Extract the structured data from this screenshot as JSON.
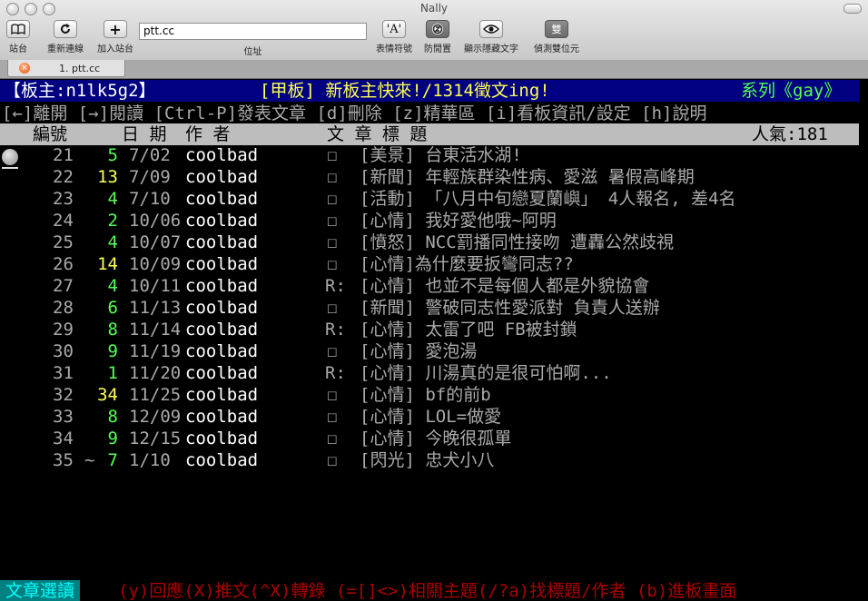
{
  "window": {
    "title": "Nally"
  },
  "toolbar": {
    "sites": {
      "label": "站台",
      "icon": "book-icon"
    },
    "reconnect": {
      "label": "重新連線",
      "icon": "reload-icon"
    },
    "add_site": {
      "label": "加入站台",
      "icon": "plus-icon"
    },
    "address": {
      "value": "ptt.cc",
      "label": "位址"
    },
    "emoticons": {
      "label": "表情符號",
      "icon": "emoticon-icon"
    },
    "anti_idle": {
      "label": "防閒置",
      "icon": "anti-idle-icon"
    },
    "show_hidden": {
      "label": "顯示隱藏文字",
      "icon": "eye-icon"
    },
    "detect_dbcs": {
      "label": "偵測雙位元",
      "icon_text": "雙"
    }
  },
  "tab": {
    "label": "1. ptt.cc"
  },
  "terminal": {
    "header": {
      "board_master": "【板主:n1lk5g2】",
      "board_title": "[甲板] 新板主快來!/1314徵文ing!",
      "series": "系列《gay》"
    },
    "menu": "[←]離開 [→]閱讀 [Ctrl-P]發表文章 [d]刪除 [z]精華區 [i]看板資訊/設定 [h]說明",
    "columns": {
      "number": "編號",
      "date": "日 期",
      "author": "作  者",
      "title": "文  章  標  題",
      "popularity": "人氣:181"
    },
    "articles": [
      {
        "num": "21",
        "mark": "",
        "count": "5",
        "date": " 7/02",
        "author": "coolbad",
        "reply": "",
        "box": "☐",
        "title": "[美景] 台東活水湖!"
      },
      {
        "num": "22",
        "mark": "",
        "count": "13",
        "date": " 7/09",
        "author": "coolbad",
        "reply": "",
        "box": "☐",
        "title": "[新聞] 年輕族群染性病、愛滋  暑假高峰期"
      },
      {
        "num": "23",
        "mark": "",
        "count": "4",
        "date": " 7/10",
        "author": "coolbad",
        "reply": "",
        "box": "☐",
        "title": "[活動] 「八月中旬戀夏蘭嶼」 4人報名, 差4名"
      },
      {
        "num": "24",
        "mark": "",
        "count": "2",
        "date": "10/06",
        "author": "coolbad",
        "reply": "",
        "box": "☐",
        "title": "[心情] 我好愛他哦~阿明"
      },
      {
        "num": "25",
        "mark": "",
        "count": "4",
        "date": "10/07",
        "author": "coolbad",
        "reply": "",
        "box": "☐",
        "title": "[憤怒] NCC罰播同性接吻  遭轟公然歧視"
      },
      {
        "num": "26",
        "mark": "",
        "count": "14",
        "date": "10/09",
        "author": "coolbad",
        "reply": "",
        "box": "☐",
        "title": "[心情]為什麼要扳彎同志??"
      },
      {
        "num": "27",
        "mark": "",
        "count": "4",
        "date": "10/11",
        "author": "coolbad",
        "reply": "R:",
        "box": "",
        "title": "[心情] 也並不是每個人都是外貌協會"
      },
      {
        "num": "28",
        "mark": "",
        "count": "6",
        "date": "11/13",
        "author": "coolbad",
        "reply": "",
        "box": "☐",
        "title": "[新聞] 警破同志性愛派對 負責人送辦"
      },
      {
        "num": "29",
        "mark": "",
        "count": "8",
        "date": "11/14",
        "author": "coolbad",
        "reply": "R:",
        "box": "",
        "title": "[心情] 太雷了吧 FB被封鎖"
      },
      {
        "num": "30",
        "mark": "",
        "count": "9",
        "date": "11/19",
        "author": "coolbad",
        "reply": "",
        "box": "☐",
        "title": "[心情] 愛泡湯"
      },
      {
        "num": "31",
        "mark": "",
        "count": "1",
        "date": "11/20",
        "author": "coolbad",
        "reply": "R:",
        "box": "",
        "title": "[心情] 川湯真的是很可怕啊..."
      },
      {
        "num": "32",
        "mark": "",
        "count": "34",
        "date": "11/25",
        "author": "coolbad",
        "reply": "",
        "box": "☐",
        "title": "[心情] bf的前b"
      },
      {
        "num": "33",
        "mark": "",
        "count": "8",
        "date": "12/09",
        "author": "coolbad",
        "reply": "",
        "box": "☐",
        "title": "[心情] LOL=做愛"
      },
      {
        "num": "34",
        "mark": "",
        "count": "9",
        "date": "12/15",
        "author": "coolbad",
        "reply": "",
        "box": "☐",
        "title": "[心情] 今晚很孤單"
      },
      {
        "num": "35",
        "mark": "~",
        "count": "7",
        "date": " 1/10",
        "author": "coolbad",
        "reply": "",
        "box": "☐",
        "title": "[閃光] 忠犬小八"
      }
    ],
    "footer": {
      "mode": "文章選讀",
      "commands": "(y)回應(X)推文(^X)轉錄 (=[]<>)相關主題(/?a)找標題/作者 (b)進板畫面"
    }
  },
  "colors": {
    "header_bg": "#000080",
    "count_yellow": "#ffff55",
    "count_green": "#55ff55",
    "footer_bg": "#008080",
    "footer_text": "#00ffff",
    "footer_cmd": "#aa0000"
  }
}
